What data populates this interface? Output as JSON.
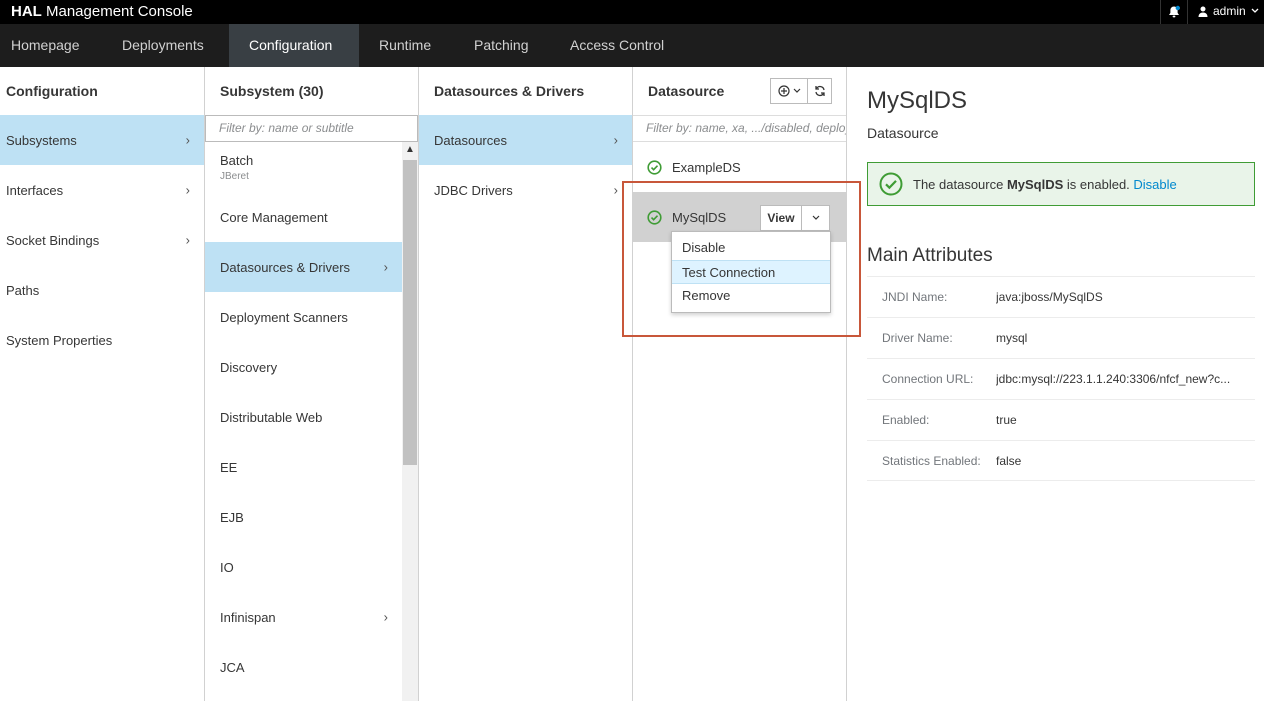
{
  "app": {
    "brand_bold": "HAL",
    "brand_rest": " Management Console"
  },
  "user": {
    "name": "admin"
  },
  "nav": [
    "Homepage",
    "Deployments",
    "Configuration",
    "Runtime",
    "Patching",
    "Access Control"
  ],
  "col1": {
    "title": "Configuration",
    "items": [
      "Subsystems",
      "Interfaces",
      "Socket Bindings",
      "Paths",
      "System Properties"
    ]
  },
  "col2": {
    "title": "Subsystem (30)",
    "filter_placeholder": "Filter by: name or subtitle",
    "items": [
      {
        "label": "Batch",
        "sub": "JBeret"
      },
      {
        "label": "Core Management"
      },
      {
        "label": "Datasources & Drivers"
      },
      {
        "label": "Deployment Scanners"
      },
      {
        "label": "Discovery"
      },
      {
        "label": "Distributable Web"
      },
      {
        "label": "EE"
      },
      {
        "label": "EJB"
      },
      {
        "label": "IO"
      },
      {
        "label": "Infinispan"
      },
      {
        "label": "JCA"
      }
    ]
  },
  "col3": {
    "title": "Datasources & Drivers",
    "items": [
      "Datasources",
      "JDBC Drivers"
    ]
  },
  "col4": {
    "title": "Datasource",
    "filter_placeholder": "Filter by: name, xa, .../disabled, deployment",
    "items": [
      "ExampleDS",
      "MySqlDS"
    ],
    "view_label": "View",
    "menu": [
      "Disable",
      "Test Connection",
      "Remove"
    ]
  },
  "preview": {
    "title": "MySqlDS",
    "subtitle": "Datasource",
    "alert_pre": "The datasource ",
    "alert_name": "MySqlDS",
    "alert_post": " is enabled. ",
    "alert_link": "Disable",
    "section": "Main Attributes",
    "attributes": [
      {
        "key": "JNDI Name:",
        "value": "java:jboss/MySqlDS"
      },
      {
        "key": "Driver Name:",
        "value": "mysql"
      },
      {
        "key": "Connection URL:",
        "value": "jdbc:mysql://223.1.1.240:3306/nfcf_new?c..."
      },
      {
        "key": "Enabled:",
        "value": "true"
      },
      {
        "key": "Statistics Enabled:",
        "value": "false"
      }
    ]
  },
  "colors": {
    "selected": "#bee1f4",
    "success": "#3f9c35",
    "link": "#0088ce",
    "highlight_border": "#c8573a"
  }
}
